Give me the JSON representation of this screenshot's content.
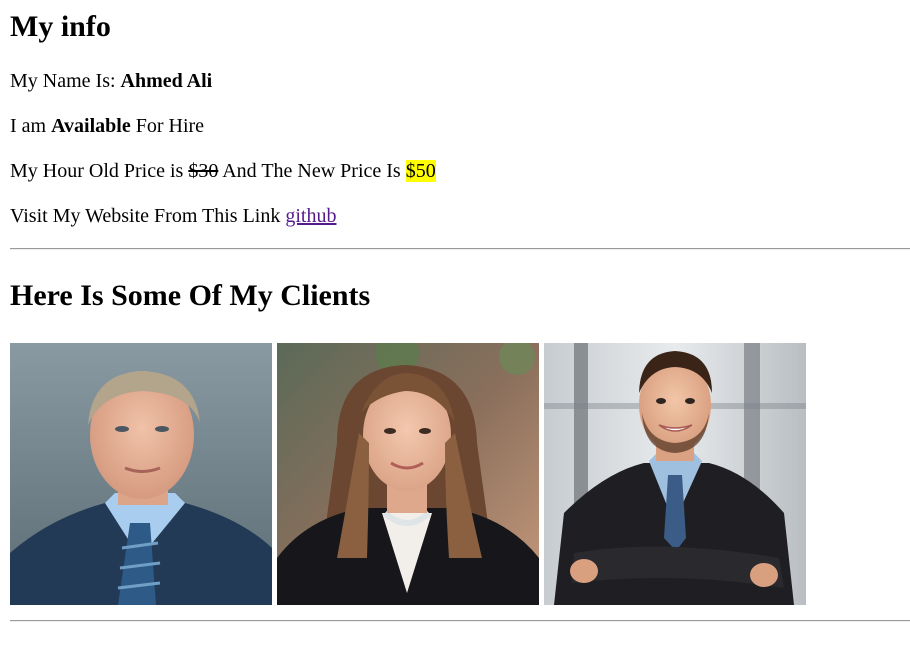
{
  "info": {
    "heading": "My info",
    "name_prefix": "My Name Is:",
    "name": "Ahmed Ali",
    "availability_prefix": "I am",
    "availability": "Available",
    "availability_suffix": "For Hire",
    "price_prefix": "My Hour Old Price is",
    "old_price": "$30",
    "price_middle": "And The New Price Is",
    "new_price": "$50",
    "link_prefix": "Visit My Website From This Link",
    "link_text": "github"
  },
  "clients": {
    "heading": "Here Is Some Of My Clients",
    "photos": [
      {
        "icon": "client-photo-man-blue-suit"
      },
      {
        "icon": "client-photo-woman-black-blazer"
      },
      {
        "icon": "client-photo-man-black-suit"
      }
    ]
  },
  "colors": {
    "highlight": "#ffff00",
    "visited_link": "#551a8b"
  }
}
